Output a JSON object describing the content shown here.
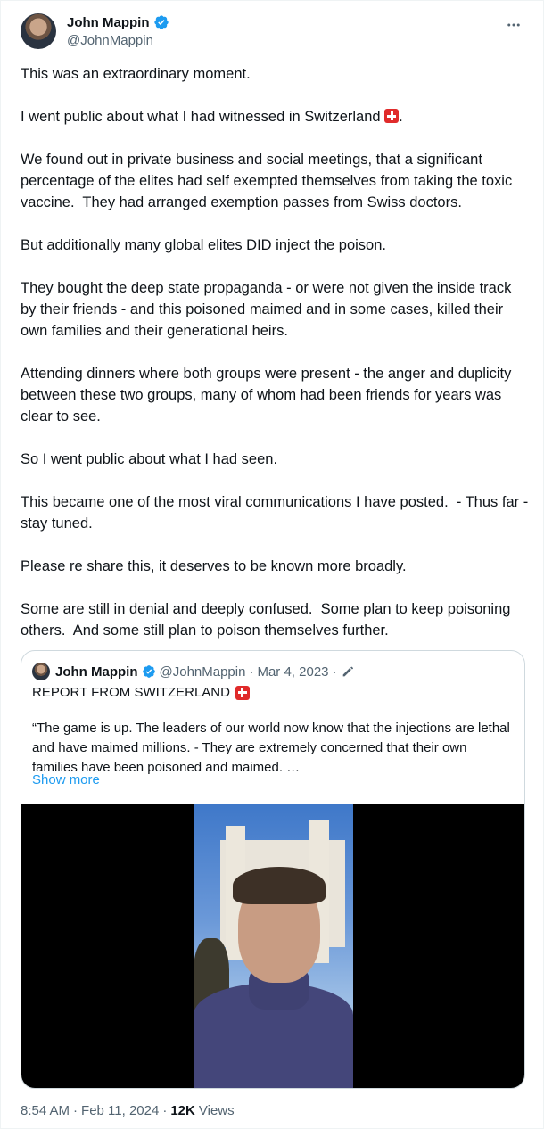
{
  "author": {
    "name": "John Mappin",
    "handle": "@JohnMappin"
  },
  "tweet": {
    "paragraphs": [
      "This was an extraordinary moment.",
      "I went public about what I had witnessed in Switzerland",
      "We found out in private business and social meetings, that a significant percentage of the elites had self exempted themselves from taking the toxic vaccine.  They had arranged exemption passes from Swiss doctors.",
      "But additionally many global elites DID inject the poison.",
      "They bought the deep state propaganda - or were not given the inside track by their friends - and this poisoned maimed and in some cases, killed their own families and their generational heirs.",
      "Attending dinners where both groups were present - the anger and duplicity between these two groups, many of whom had been friends for years was clear to see.",
      "So I went public about what I had seen.",
      "This became one of the most viral communications I have posted.  - Thus far -  stay tuned.",
      "Please re share this, it deserves to be known more broadly.",
      "Some are still in denial and deeply confused.  Some plan to keep poisoning others.  And some still plan to poison themselves further."
    ],
    "period_after_flag": "."
  },
  "quoted": {
    "name": "John Mappin",
    "handle": "@JohnMappin",
    "separator": "·",
    "date": "Mar 4, 2023",
    "title": "REPORT FROM SWITZERLAND",
    "text": "“The game is up. The leaders of our world now know that the injections are lethal and have maimed millions.  -  They are extremely concerned that their own families have been poisoned and maimed.  …",
    "show_more": "Show more"
  },
  "meta": {
    "time": "8:54 AM",
    "date": "Feb 11, 2024",
    "separator": "·",
    "views_count": "12K",
    "views_label": "Views"
  },
  "colors": {
    "accent": "#1d9bf0",
    "muted": "#536471",
    "text": "#0f1419",
    "swiss_flag": "#e02b2b"
  },
  "icons": {
    "verified": "verified-badge-icon",
    "more": "more-dots-icon",
    "edit": "edit-pencil-icon",
    "flag": "swiss-flag-icon"
  }
}
